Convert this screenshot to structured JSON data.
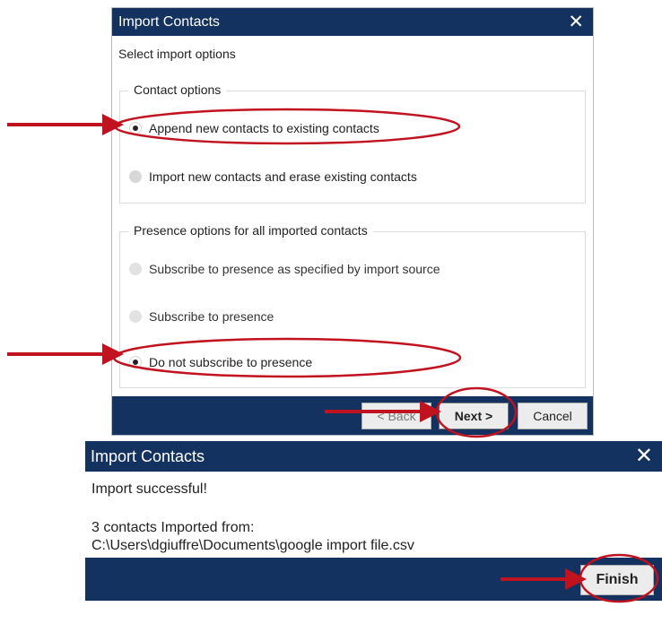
{
  "colors": {
    "titlebar": "#14325f",
    "annotation": "#c1121f",
    "button_bg": "#ececec"
  },
  "dialog_options": {
    "title": "Import Contacts",
    "close_glyph": "✕",
    "subtitle": "Select import options",
    "contact_group": {
      "legend": "Contact options",
      "options": [
        {
          "label": "Append new contacts to existing contacts",
          "selected": true
        },
        {
          "label": "Import new contacts and erase existing contacts",
          "selected": false
        }
      ]
    },
    "presence_group": {
      "legend": "Presence options for all imported contacts",
      "options": [
        {
          "label": "Subscribe to presence as specified by import source",
          "selected": false
        },
        {
          "label": "Subscribe to presence",
          "selected": false
        },
        {
          "label": "Do not subscribe to presence",
          "selected": true
        }
      ]
    },
    "buttons": {
      "back": "< Back",
      "next": "Next >",
      "cancel": "Cancel"
    }
  },
  "dialog_result": {
    "title": "Import Contacts",
    "close_glyph": "✕",
    "message": "Import successful!",
    "count_line": "3 contacts Imported from:",
    "file_path": "C:\\Users\\dgiuffre\\Documents\\google import file.csv",
    "finish_label": "Finish"
  }
}
